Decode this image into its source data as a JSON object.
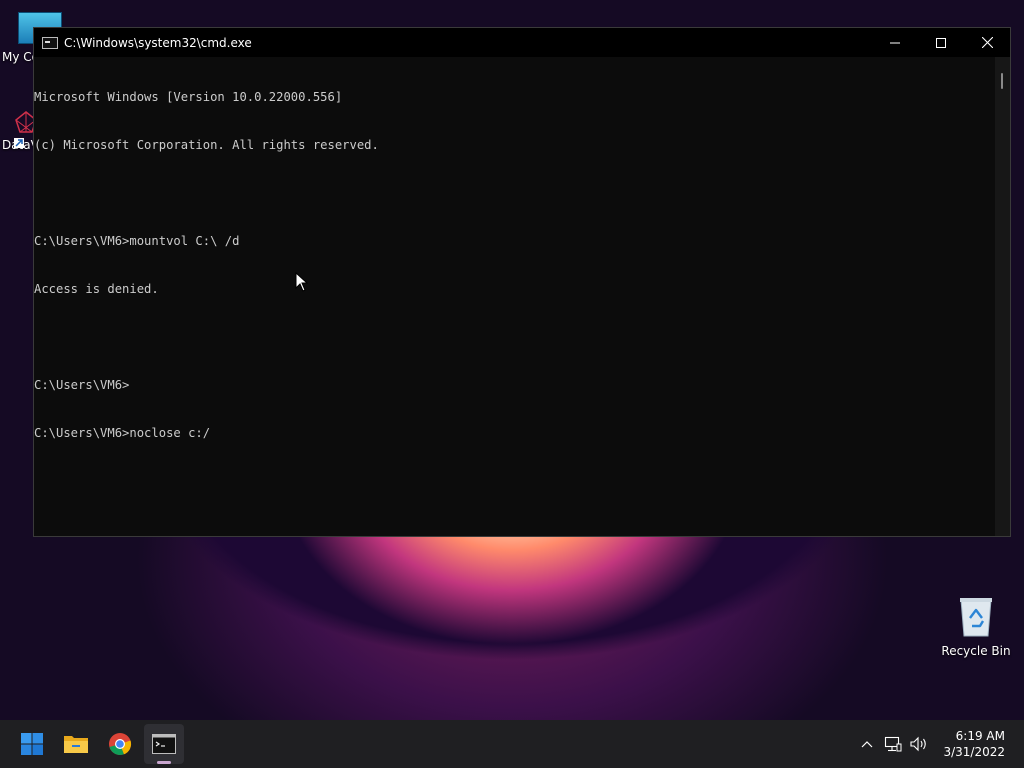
{
  "desktop": {
    "icons": [
      {
        "label": "My Co"
      },
      {
        "label": "DataV"
      },
      {
        "label": "Recycle Bin"
      }
    ]
  },
  "window": {
    "title": "C:\\Windows\\system32\\cmd.exe",
    "console_lines": [
      "Microsoft Windows [Version 10.0.22000.556]",
      "(c) Microsoft Corporation. All rights reserved.",
      "",
      "C:\\Users\\VM6>mountvol C:\\ /d",
      "Access is denied.",
      "",
      "C:\\Users\\VM6>",
      "C:\\Users\\VM6>noclose c:/"
    ]
  },
  "taskbar": {
    "apps": [
      {
        "name": "Start",
        "icon": "windows-start-icon"
      },
      {
        "name": "File Explorer",
        "icon": "folder-icon"
      },
      {
        "name": "Google Chrome",
        "icon": "chrome-icon"
      },
      {
        "name": "Command Prompt",
        "icon": "cmd-icon",
        "active": true
      }
    ],
    "clock_time": "6:19 AM",
    "clock_date": "3/31/2022"
  },
  "colors": {
    "console_bg": "#0c0c0c",
    "console_text": "#cccccc",
    "taskbar_bg": "#1f1f22"
  }
}
